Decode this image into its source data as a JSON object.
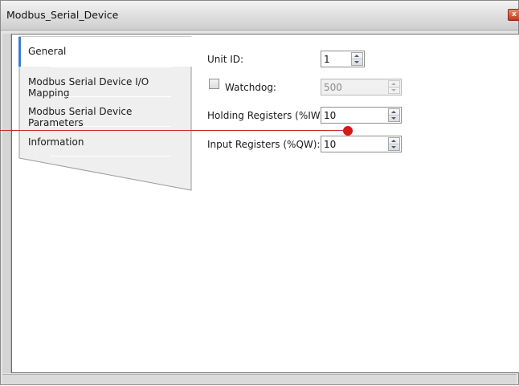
{
  "window": {
    "title": "Modbus_Serial_Device",
    "close_glyph": "x"
  },
  "tabs": [
    {
      "label": "General",
      "active": true
    },
    {
      "label": "Modbus Serial Device I/O Mapping",
      "active": false
    },
    {
      "label": "Modbus Serial Device Parameters",
      "active": false
    },
    {
      "label": "Information",
      "active": false
    }
  ],
  "general": {
    "unit_id": {
      "label": "Unit ID:",
      "value": "1"
    },
    "watchdog": {
      "label": "Watchdog:",
      "value": "500",
      "checked": false,
      "enabled": false
    },
    "holding_registers": {
      "label": "Holding Registers (%IW):",
      "value": "10"
    },
    "input_registers": {
      "label": "Input Registers (%QW):",
      "value": "10"
    }
  },
  "colors": {
    "active_tab_accent": "#3b7ccf",
    "marker": "#d41a1a"
  },
  "icons": {
    "close": "close-icon",
    "spin_up": "chevron-up-icon",
    "spin_down": "chevron-down-icon"
  }
}
